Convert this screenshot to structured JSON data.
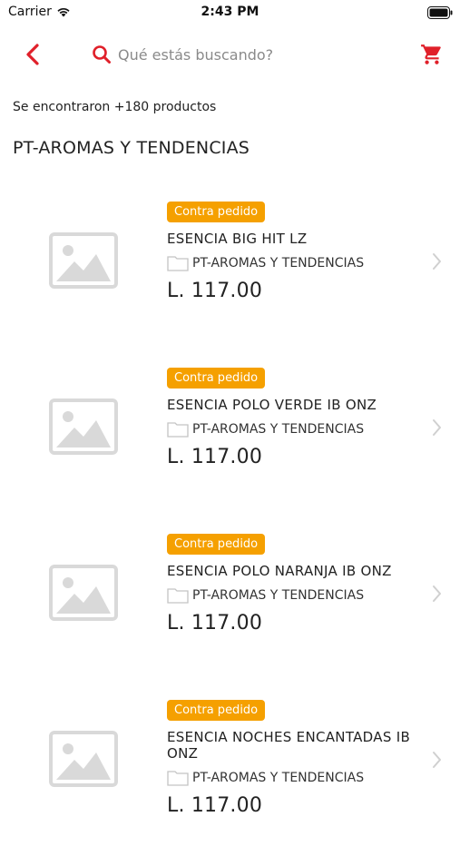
{
  "status_bar": {
    "carrier": "Carrier",
    "time": "2:43 PM"
  },
  "nav": {
    "back_icon": "chevron-left-icon",
    "search_icon": "search-icon",
    "search_placeholder": "Qué estás buscando?",
    "search_value": "",
    "cart_icon": "shopping-cart-icon"
  },
  "results": {
    "count_text": "Se encontraron +180 productos",
    "category_title": "PT-AROMAS Y TENDENCIAS"
  },
  "colors": {
    "accent": "#e0202a",
    "badge": "#f5a000",
    "placeholder_image": "#d9d9d9"
  },
  "products": [
    {
      "badge": "Contra pedido",
      "name": "ESENCIA BIG HIT LZ",
      "category": "PT-AROMAS Y TENDENCIAS",
      "price": "L. 117.00"
    },
    {
      "badge": "Contra pedido",
      "name": "ESENCIA POLO VERDE IB ONZ",
      "category": "PT-AROMAS Y TENDENCIAS",
      "price": "L. 117.00"
    },
    {
      "badge": "Contra pedido",
      "name": "ESENCIA POLO NARANJA IB ONZ",
      "category": "PT-AROMAS Y TENDENCIAS",
      "price": "L. 117.00"
    },
    {
      "badge": "Contra pedido",
      "name": "ESENCIA NOCHES ENCANTADAS IB ONZ",
      "category": "PT-AROMAS Y TENDENCIAS",
      "price": "L. 117.00"
    }
  ]
}
